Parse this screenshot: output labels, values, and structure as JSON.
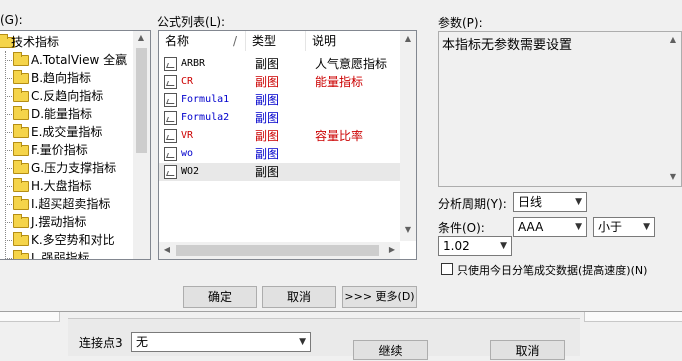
{
  "labels": {
    "tree_label": "(G):",
    "formula_list_label": "公式列表(L):",
    "params_label": "参数(P):",
    "params_text": "本指标无参数需要设置",
    "period_label": "分析周期(Y):",
    "condition_label": "条件(O):",
    "checkbox_label": "只使用今日分笔成交数据(提高速度)(N)",
    "connect_label": "连接点3"
  },
  "tree": {
    "root": "技术指标",
    "items": [
      "A.TotalView 全嬴",
      "B.趋向指标",
      "C.反趋向指标",
      "D.能量指标",
      "E.成交量指标",
      "F.量价指标",
      "G.压力支撑指标",
      "H.大盘指标",
      "I.超买超卖指标",
      "J.摆动指标",
      "K.多空势和对比",
      "L.强弱指标"
    ]
  },
  "formula_list": {
    "columns": [
      "名称",
      "类型",
      "说明"
    ],
    "sort_mark": "/",
    "rows": [
      {
        "name": "ARBR",
        "type": "副图",
        "desc": "人气意愿指标",
        "color": "#000000"
      },
      {
        "name": "CR",
        "type": "副图",
        "desc": "能量指标",
        "color": "#cc0000"
      },
      {
        "name": "Formula1",
        "type": "副图",
        "desc": "",
        "color": "#0000cc"
      },
      {
        "name": "Formula2",
        "type": "副图",
        "desc": "",
        "color": "#0000cc"
      },
      {
        "name": "VR",
        "type": "副图",
        "desc": "容量比率",
        "color": "#cc0000"
      },
      {
        "name": "wo",
        "type": "副图",
        "desc": "",
        "color": "#0000cc"
      },
      {
        "name": "WO2",
        "type": "副图",
        "desc": "",
        "color": "#000000"
      }
    ]
  },
  "controls": {
    "period_value": "日线",
    "condition_a": "AAA",
    "condition_op": "小于",
    "condition_value": "1.02",
    "connect_value": "无"
  },
  "buttons": {
    "ok": "确定",
    "cancel": "取消",
    "more": ">>> 更多(D)",
    "continue": "继续",
    "cancel2": "取消"
  }
}
